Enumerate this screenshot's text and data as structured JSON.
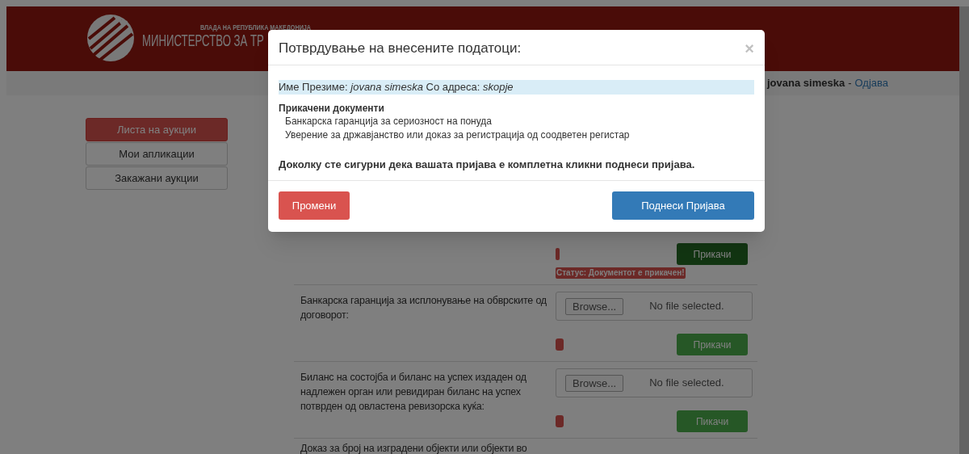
{
  "header": {
    "government": "ВЛАДА НА РЕПУБЛИКА МАКЕДОНИЈА",
    "ministry": "МИНИСТЕРСТВО ЗА ТР"
  },
  "user_bar": {
    "user": "jovana simeska",
    "separator": "-",
    "logout": "Одјава"
  },
  "menu": [
    {
      "label": "Листа на аукции",
      "selected": true
    },
    {
      "label": "Мои апликации",
      "selected": false
    },
    {
      "label": "Закажани аукции",
      "selected": false
    }
  ],
  "documents": [
    {
      "upload_button": "Прикачи",
      "disabled": false,
      "status": "Статус: Документот е прикачен!"
    },
    {
      "label": "Банкарска гаранција за исплонување на обврските од договорот:",
      "file_button": "Browse...",
      "file_status": "No file selected.",
      "upload_button": "Прикачи",
      "disabled": true
    },
    {
      "label": "Биланс на состојба и биланс на успех издаден од надлежен орган или ревидиран биланс на успех потврден од овластена ревизорска куќа:",
      "file_button": "Browse...",
      "file_status": "No file selected.",
      "upload_button": "Пикачи",
      "disabled": true
    },
    {
      "label": "Доказ за број на изградени објекти или објекти во"
    }
  ],
  "modal": {
    "title": "Потврдување на внесените податоци:",
    "close": "×",
    "summary": "Име Презиме: *jovana simeska* Со адреса: *skopje*",
    "attached_heading": "Прикачени документи",
    "attached": [
      "Банкарска гаранција за сериозност на понуда",
      "Уверение за државјанство или доказ за регистрација од соодветен регистар"
    ],
    "confirm_text": "Доколку сте сигурни дека вашата пријава е комплетна кликни поднеси пријава.",
    "buttons": [
      {
        "kind": "danger",
        "label": "Промени"
      },
      {
        "kind": "primary",
        "label": "Поднеси Пријава"
      }
    ]
  }
}
